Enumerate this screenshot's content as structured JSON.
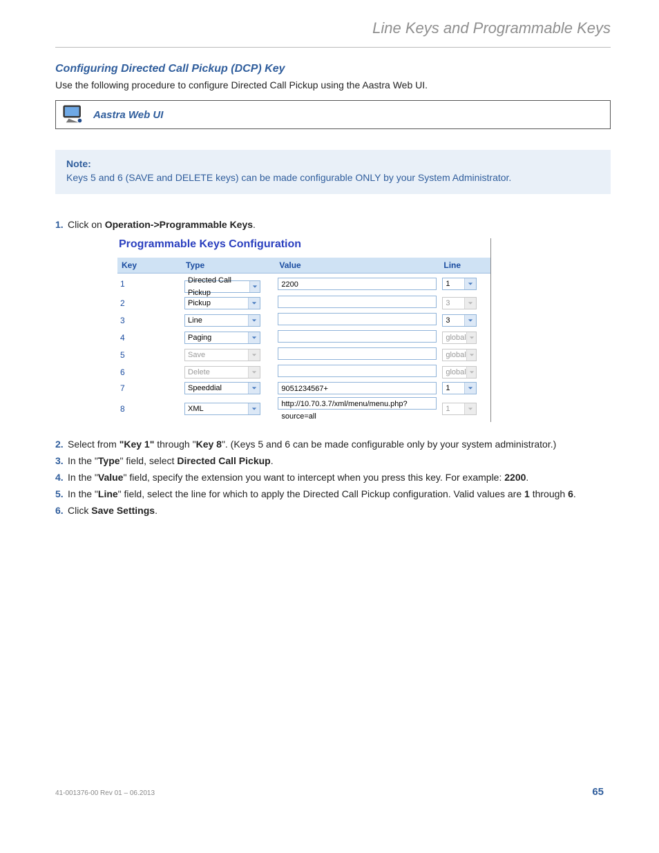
{
  "chapter_title": "Line Keys and Programmable Keys",
  "section_title": "Configuring Directed Call Pickup (DCP) Key",
  "intro_text": "Use the following procedure to configure Directed Call Pickup using the Aastra Web UI.",
  "webui_label": "Aastra Web UI",
  "note": {
    "label": "Note:",
    "body": "Keys 5 and 6 (SAVE and DELETE keys) can be made configurable ONLY by your System Administrator."
  },
  "steps": {
    "s1_pre": "Click on ",
    "s1_b": "Operation->Programmable Keys",
    "s1_post": ".",
    "s2_pre": "Select from ",
    "s2_b1": "\"Key 1\"",
    "s2_mid": " through \"",
    "s2_b2": "Key 8",
    "s2_post": "\". (Keys 5 and 6 can be made configurable only by your system administrator.)",
    "s3_pre": "In the \"",
    "s3_b1": "Type",
    "s3_mid": "\" field, select ",
    "s3_b2": "Directed Call Pickup",
    "s3_post": ".",
    "s4_pre": "In the \"",
    "s4_b1": "Value",
    "s4_mid": "\" field, specify the extension you want to intercept when you press this key. For example: ",
    "s4_b2": "2200",
    "s4_post": ".",
    "s5_pre": "In the \"",
    "s5_b1": "Line",
    "s5_mid": "\" field, select the line for which to apply the Directed Call Pickup configuration. Valid values are ",
    "s5_b2": "1",
    "s5_mid2": " through ",
    "s5_b3": "6",
    "s5_post": ".",
    "s6_pre": "Click ",
    "s6_b": "Save Settings",
    "s6_post": "."
  },
  "screenshot": {
    "title": "Programmable Keys Configuration",
    "headers": {
      "key": "Key",
      "type": "Type",
      "value": "Value",
      "line": "Line"
    },
    "rows": [
      {
        "key": "1",
        "type": "Directed Call Pickup",
        "type_disabled": false,
        "value": "2200",
        "line": "1",
        "line_disabled": false
      },
      {
        "key": "2",
        "type": "Pickup",
        "type_disabled": false,
        "value": "",
        "line": "3",
        "line_disabled": true
      },
      {
        "key": "3",
        "type": "Line",
        "type_disabled": false,
        "value": "",
        "line": "3",
        "line_disabled": false
      },
      {
        "key": "4",
        "type": "Paging",
        "type_disabled": false,
        "value": "",
        "line": "global",
        "line_disabled": true
      },
      {
        "key": "5",
        "type": "Save",
        "type_disabled": true,
        "value": "",
        "line": "global",
        "line_disabled": true
      },
      {
        "key": "6",
        "type": "Delete",
        "type_disabled": true,
        "value": "",
        "line": "global",
        "line_disabled": true
      },
      {
        "key": "7",
        "type": "Speeddial",
        "type_disabled": false,
        "value": "9051234567+",
        "line": "1",
        "line_disabled": false
      },
      {
        "key": "8",
        "type": "XML",
        "type_disabled": false,
        "value": "http://10.70.3.7/xml/menu/menu.php?source=all",
        "line": "1",
        "line_disabled": true
      }
    ]
  },
  "footer": {
    "docref": "41-001376-00 Rev 01 – 06.2013",
    "page": "65"
  }
}
